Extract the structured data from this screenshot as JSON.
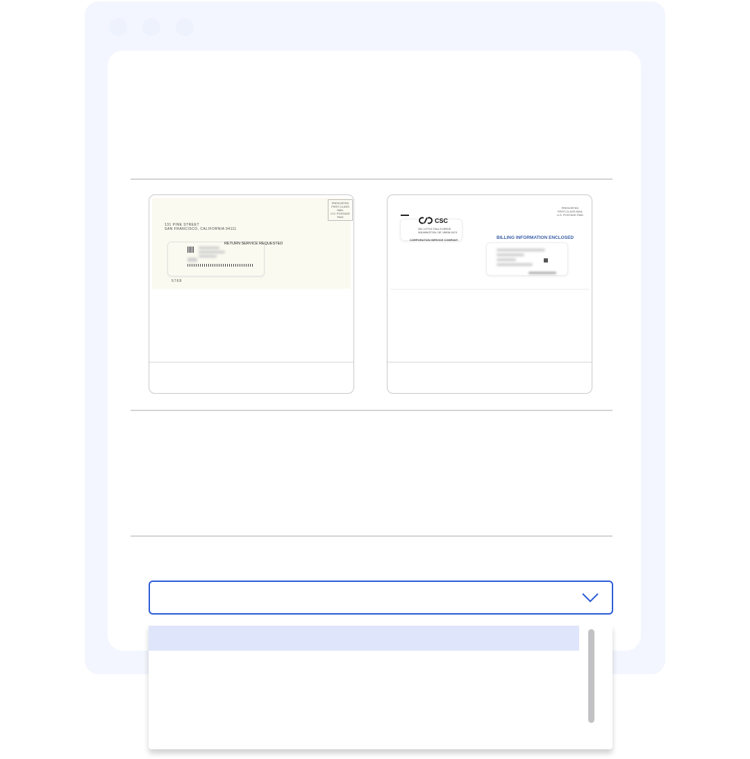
{
  "colors": {
    "frame_bg": "#f3f6fe",
    "panel_bg": "#ffffff",
    "accent": "#2b5bd7",
    "option_highlight": "#dfe6fb",
    "csc_blue": "#3a5ea8"
  },
  "cards": [
    {
      "sender_lines": [
        "131 PINE STREET",
        "SAN FRANCISCO, CALIFORNIA 94111"
      ],
      "stamp_lines": [
        "PRESORTED",
        "FIRST-CLASS MAIL",
        "U.S. POSTAGE PAID"
      ],
      "endorsement": "RETURN SERVICE REQUESTED",
      "number": "5768"
    },
    {
      "logo_text": "CSC",
      "sender_lines": [
        "251 LITTLE FALLS DRIVE",
        "WILMINGTON, DE 19808-1674"
      ],
      "extra_line": "CORPORATION SERVICE COMPANY",
      "stamp_lines": [
        "PRESORTED",
        "FIRST-CLASS MAIL",
        "U.S. POSTAGE PAID"
      ],
      "headline": "BILLING INFORMATION ENCLOSED"
    }
  ],
  "select": {
    "icon": "chevron-down-icon"
  }
}
